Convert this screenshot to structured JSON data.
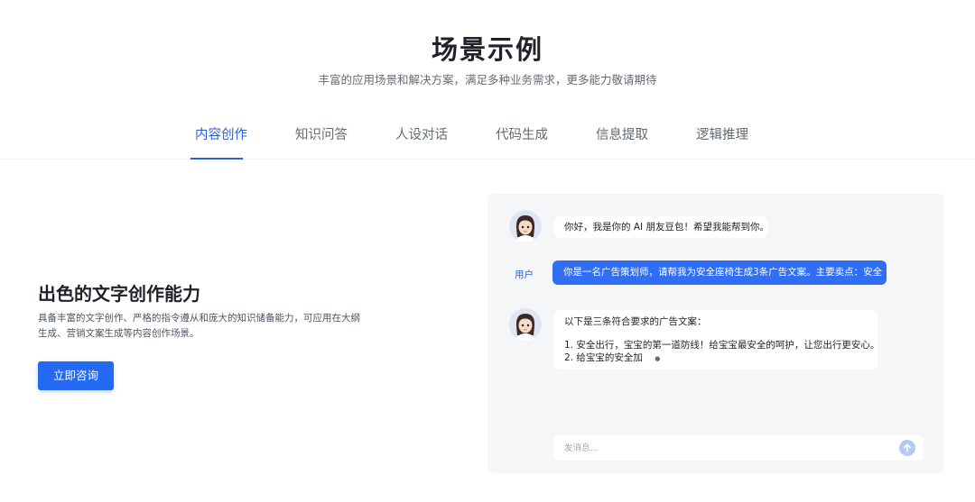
{
  "header": {
    "title": "场景示例",
    "subtitle": "丰富的应用场景和解决方案，满足多种业务需求，更多能力敬请期待"
  },
  "tabs": [
    {
      "label": "内容创作",
      "active": true
    },
    {
      "label": "知识问答",
      "active": false
    },
    {
      "label": "人设对话",
      "active": false
    },
    {
      "label": "代码生成",
      "active": false
    },
    {
      "label": "信息提取",
      "active": false
    },
    {
      "label": "逻辑推理",
      "active": false
    }
  ],
  "feature": {
    "title": "出色的文字创作能力",
    "description_line1": "具备丰富的文字创作、严格的指令遵从和庞大的知识储备能力，可应用在大纲",
    "description_line2": "生成、营销文案生成等内容创作场景。",
    "cta_label": "立即咨询"
  },
  "chat": {
    "greeting": "你好，我是你的 AI 朋友豆包！希望我能帮到你。",
    "user_label": "用户",
    "user_message": "你是一名广告策划师，请帮我为安全座椅生成3条广告文案。主要卖点：安全",
    "reply_intro": "以下是三条符合要求的广告文案：",
    "reply_line1": "1. 安全出行，宝宝的第一道防线！给宝宝最安全的呵护，让您出行更安心。",
    "reply_line2": "2. 给宝宝的安全加",
    "typing_indicator": "●",
    "input_placeholder": "发消息..."
  },
  "icons": {
    "assistant_avatar": "assistant-avatar-icon",
    "send": "send-arrow-icon"
  },
  "colors": {
    "accent": "#2c63d6",
    "button": "#2469f1",
    "user_bubble": "#2f6ef5",
    "panel_bg": "#f5f6f8"
  }
}
